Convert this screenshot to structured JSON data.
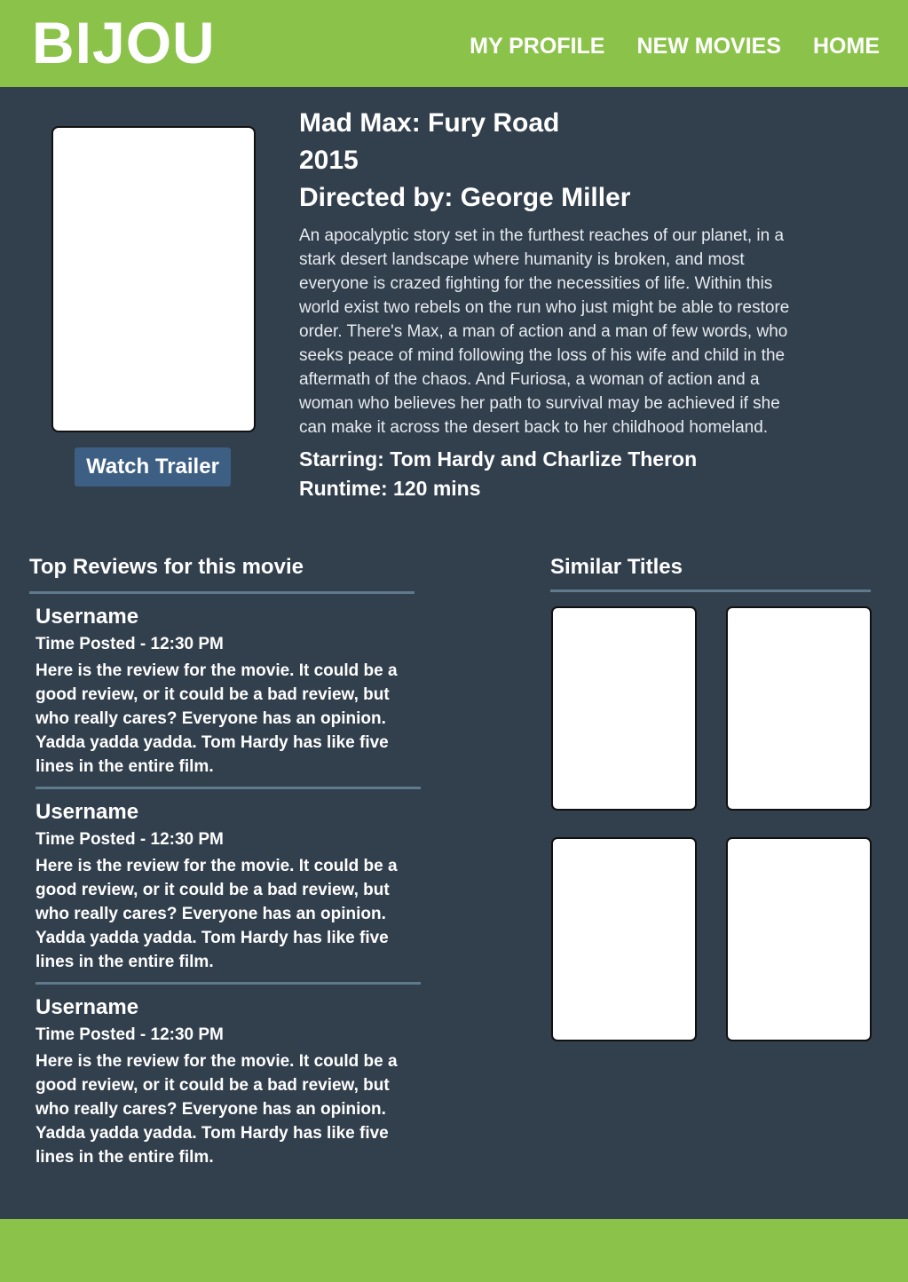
{
  "header": {
    "logo": "BIJOU",
    "nav": [
      "MY PROFILE",
      "NEW MOVIES",
      "HOME"
    ]
  },
  "movie": {
    "title": "Mad Max: Fury Road",
    "year": "2015",
    "director": "Directed by: George Miller",
    "synopsis": "An apocalyptic story set in the furthest reaches of our planet, in a stark desert landscape where humanity is broken, and most everyone is crazed fighting for the necessities of life. Within this world exist two rebels on the run who just might be able to restore order. There's Max, a man of action and a man of few words, who seeks peace of mind following the loss of his wife and child in the aftermath of the chaos. And Furiosa, a woman of action and a woman who believes her path to survival may be achieved if she can make it across the desert back to her childhood homeland.",
    "starring": "Starring: Tom Hardy and Charlize Theron",
    "runtime": "Runtime: 120 mins",
    "trailer_label": "Watch Trailer"
  },
  "reviews": {
    "title": "Top Reviews for this movie",
    "items": [
      {
        "username": "Username",
        "time": "Time Posted - 12:30 PM",
        "text": "Here is the review for the movie. It could be a good review, or it could be a bad review, but who really cares? Everyone has an opinion. Yadda yadda yadda. Tom Hardy has like five lines in the entire film."
      },
      {
        "username": "Username",
        "time": "Time Posted - 12:30 PM",
        "text": "Here is the review for the movie. It could be a good review, or it could be a bad review, but who really cares? Everyone has an opinion. Yadda yadda yadda. Tom Hardy has like five lines in the entire film."
      },
      {
        "username": "Username",
        "time": "Time Posted - 12:30 PM",
        "text": "Here is the review for the movie. It could be a good review, or it could be a bad review, but who really cares? Everyone has an opinion. Yadda yadda yadda. Tom Hardy has like five lines in the entire film."
      }
    ]
  },
  "similar": {
    "title": "Similar Titles"
  },
  "colors": {
    "header_bg": "#8bc34a",
    "page_bg": "#323f4d",
    "button_bg": "#3d5f84",
    "divider": "#5f7a8c"
  }
}
